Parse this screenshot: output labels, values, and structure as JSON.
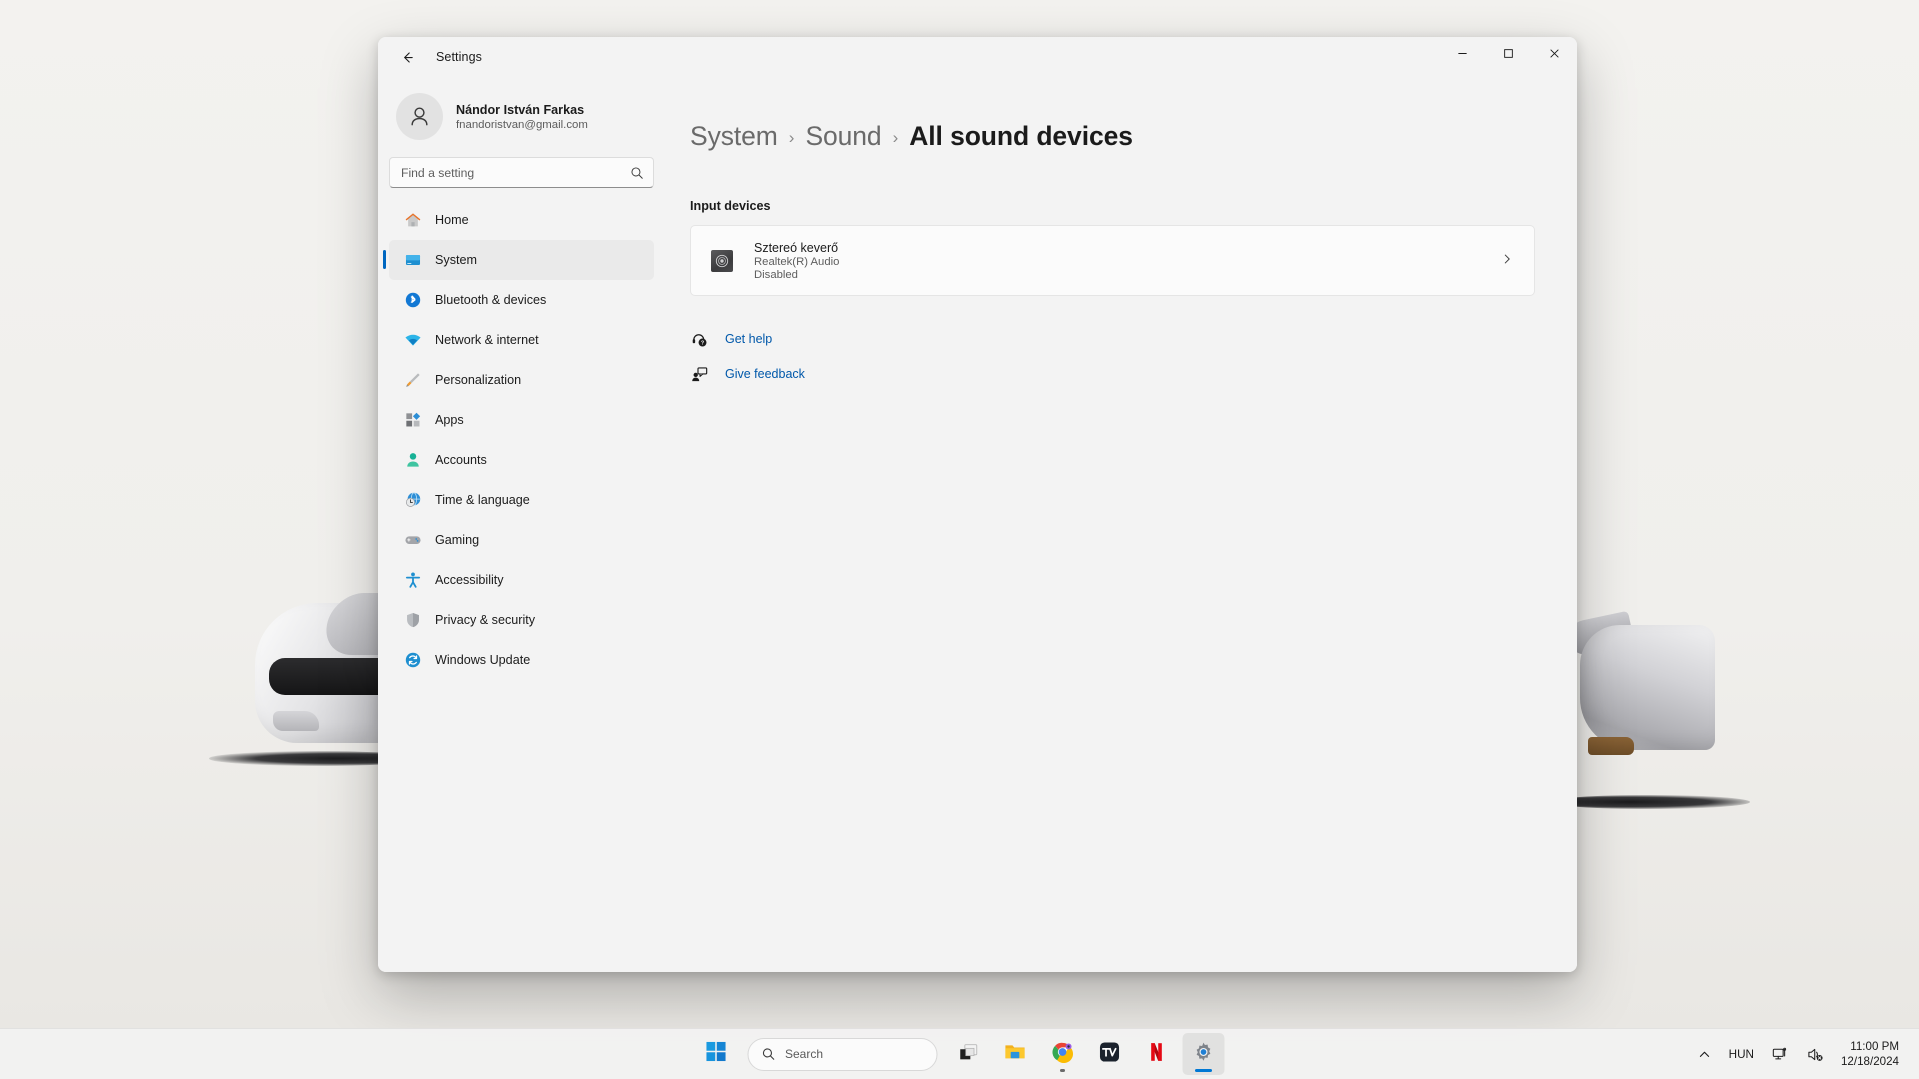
{
  "window": {
    "title": "Settings",
    "back_icon": "back-arrow-icon",
    "minimize_label": "−",
    "maximize_label": "□",
    "close_label": "✕"
  },
  "account": {
    "name": "Nándor István Farkas",
    "email": "fnandoristvan@gmail.com",
    "avatar_icon": "person-avatar-icon"
  },
  "search": {
    "placeholder": "Find a setting",
    "value": "",
    "icon": "search-icon"
  },
  "sidebar": {
    "items": [
      {
        "label": "Home",
        "icon": "home-icon",
        "selected": false
      },
      {
        "label": "System",
        "icon": "monitor-icon",
        "selected": true
      },
      {
        "label": "Bluetooth & devices",
        "icon": "bluetooth-icon",
        "selected": false
      },
      {
        "label": "Network & internet",
        "icon": "wifi-icon",
        "selected": false
      },
      {
        "label": "Personalization",
        "icon": "paintbrush-icon",
        "selected": false
      },
      {
        "label": "Apps",
        "icon": "apps-grid-icon",
        "selected": false
      },
      {
        "label": "Accounts",
        "icon": "person-icon",
        "selected": false
      },
      {
        "label": "Time & language",
        "icon": "clock-globe-icon",
        "selected": false
      },
      {
        "label": "Gaming",
        "icon": "gamepad-icon",
        "selected": false
      },
      {
        "label": "Accessibility",
        "icon": "accessibility-icon",
        "selected": false
      },
      {
        "label": "Privacy & security",
        "icon": "shield-icon",
        "selected": false
      },
      {
        "label": "Windows Update",
        "icon": "update-refresh-icon",
        "selected": false
      }
    ]
  },
  "breadcrumb": {
    "separator": "›",
    "items": [
      {
        "label": "System",
        "current": false
      },
      {
        "label": "Sound",
        "current": false
      },
      {
        "label": "All sound devices",
        "current": true
      }
    ]
  },
  "main": {
    "section_title": "Input devices",
    "device": {
      "name": "Sztereó keverő",
      "driver": "Realtek(R) Audio",
      "status": "Disabled",
      "icon": "audio-mixer-icon",
      "chevron": "›"
    },
    "links": [
      {
        "label": "Get help",
        "icon": "help-question-icon"
      },
      {
        "label": "Give feedback",
        "icon": "feedback-person-icon"
      }
    ]
  },
  "taskbar": {
    "start_icon": "windows-start-icon",
    "search_placeholder": "Search",
    "search_icon": "search-icon",
    "buttons": [
      {
        "name": "task-view",
        "icon": "task-view-icon",
        "running": false,
        "active": false
      },
      {
        "name": "file-explorer",
        "icon": "file-explorer-icon",
        "running": false,
        "active": false
      },
      {
        "name": "chrome",
        "icon": "chrome-icon",
        "running": true,
        "active": false
      },
      {
        "name": "tradingview",
        "icon": "tradingview-icon",
        "running": false,
        "active": false
      },
      {
        "name": "netflix",
        "icon": "netflix-icon",
        "running": false,
        "active": false
      },
      {
        "name": "settings",
        "icon": "settings-gear-icon",
        "running": true,
        "active": true
      }
    ],
    "tray": {
      "overflow_icon": "chevron-up-icon",
      "language": "HUN",
      "network_icon": "network-display-icon",
      "volume_icon": "speaker-muted-icon",
      "time": "11:00 PM",
      "date": "12/18/2024"
    }
  },
  "colors": {
    "accent": "#0078d4",
    "selection_bar": "#0067c0",
    "link": "#0058aa",
    "window_bg": "#f3f3f3",
    "card_bg": "#fbfbfb"
  }
}
